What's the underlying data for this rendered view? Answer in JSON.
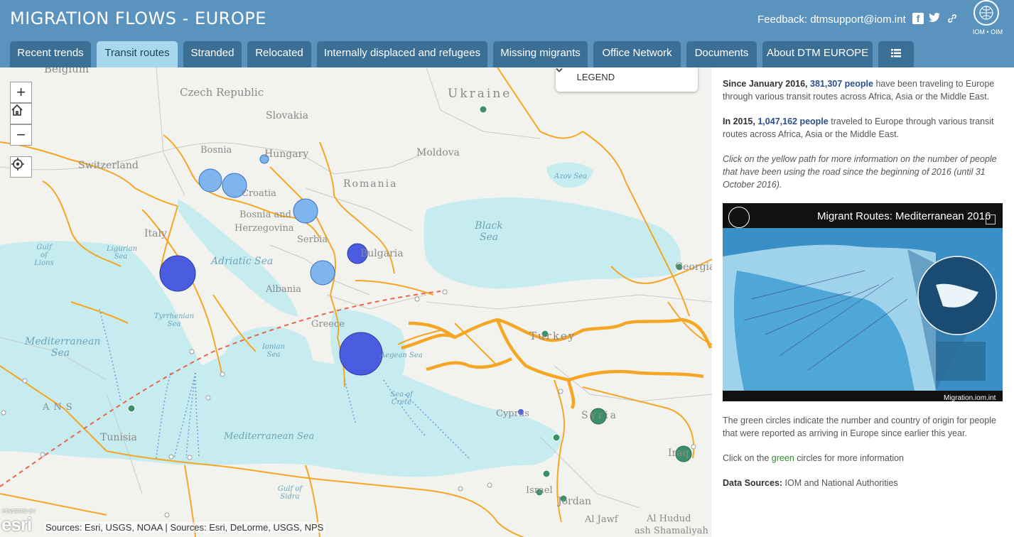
{
  "header": {
    "title": "MIGRATION FLOWS - EUROPE",
    "feedback": "Feedback: dtmsupport@iom.int",
    "logo_text": "IOM • OIM",
    "icons": [
      "facebook-icon",
      "twitter-icon",
      "link-icon",
      "iom-logo"
    ]
  },
  "tabs": [
    {
      "label": "Recent trends",
      "active": false
    },
    {
      "label": "Transit routes",
      "active": true
    },
    {
      "label": "Stranded",
      "active": false
    },
    {
      "label": "Relocated",
      "active": false
    },
    {
      "label": "Internally displaced and refugees",
      "active": false
    },
    {
      "label": "Missing migrants",
      "active": false
    },
    {
      "label": "Office Network",
      "active": false
    },
    {
      "label": "Documents",
      "active": false
    },
    {
      "label": "About DTM EUROPE",
      "active": false
    },
    {
      "label": "",
      "icon": "list-icon",
      "active": false
    }
  ],
  "map": {
    "zoom_in": "+",
    "zoom_out": "−",
    "legend_label": "LEGEND",
    "powered_by": "POWERED BY",
    "esri": "esri",
    "sources": "Sources: Esri, USGS, NOAA | Sources: Esri, DeLorme, USGS, NPS",
    "colors": {
      "land": "#f2f2ef",
      "sea": "#c6ecf0",
      "route": "#f5a623",
      "blue_circle": "#4a5de0",
      "light_blue_circle": "#7fb5ef",
      "green_circle": "#3d8f6a",
      "dashed": "#e8654a"
    },
    "country_labels": [
      "Belgium",
      "Czech Republic",
      "Ukraine",
      "Slovakia",
      "Moldova",
      "Switzerland",
      "Bosnia",
      "Hungary",
      "Romania",
      "Croatia",
      "Bosnia and",
      "Herzegovina",
      "Serbia",
      "Bulgaria",
      "Italy",
      "Albania",
      "Greece",
      "Turkey",
      "Georgia",
      "Tunisia",
      "Cyprus",
      "Syria",
      "Iraq",
      "Israel",
      "Jordan",
      "Al Jawf",
      "Al Hudud",
      "ash Shamaliyah",
      "ANS"
    ],
    "sea_labels": [
      "Gulf of Lions",
      "Ligurian Sea",
      "Adriatic Sea",
      "Tyrrhenian Sea",
      "Mediterranean Sea",
      "Ionian Sea",
      "Aegean Sea",
      "Sea of Crete",
      "Black Sea",
      "Azov Sea",
      "Mediterranean Sea",
      "Gulf of Sidra"
    ]
  },
  "sidebar": {
    "p1_a": "Since January 2016,",
    "p1_num": "381,307 people",
    "p1_b": "have been traveling to Europe through various transit routes across Africa, Asia or the Middle East.",
    "p2_a": "In 2015,",
    "p2_num": "1,047,162 people",
    "p2_b": "traveled to Europe through various transit routes across Africa, Asia or the Middle East.",
    "p3": "Click on the yellow path for more information on the number of people that have been using the road since the beginning of 2016 (until 31 October 2016).",
    "video_title": "Migrant Routes: Mediterranean 2016",
    "video_brand": "Migration.iom.int",
    "p4": "The green circles indicate the number and country of origin for people that were reported as arriving in Europe since earlier this year.",
    "p5_a": "Click on the",
    "p5_green": "green",
    "p5_b": "circles for more information",
    "p6_label": "Data Sources:",
    "p6_value": "IOM and National Authorities"
  }
}
